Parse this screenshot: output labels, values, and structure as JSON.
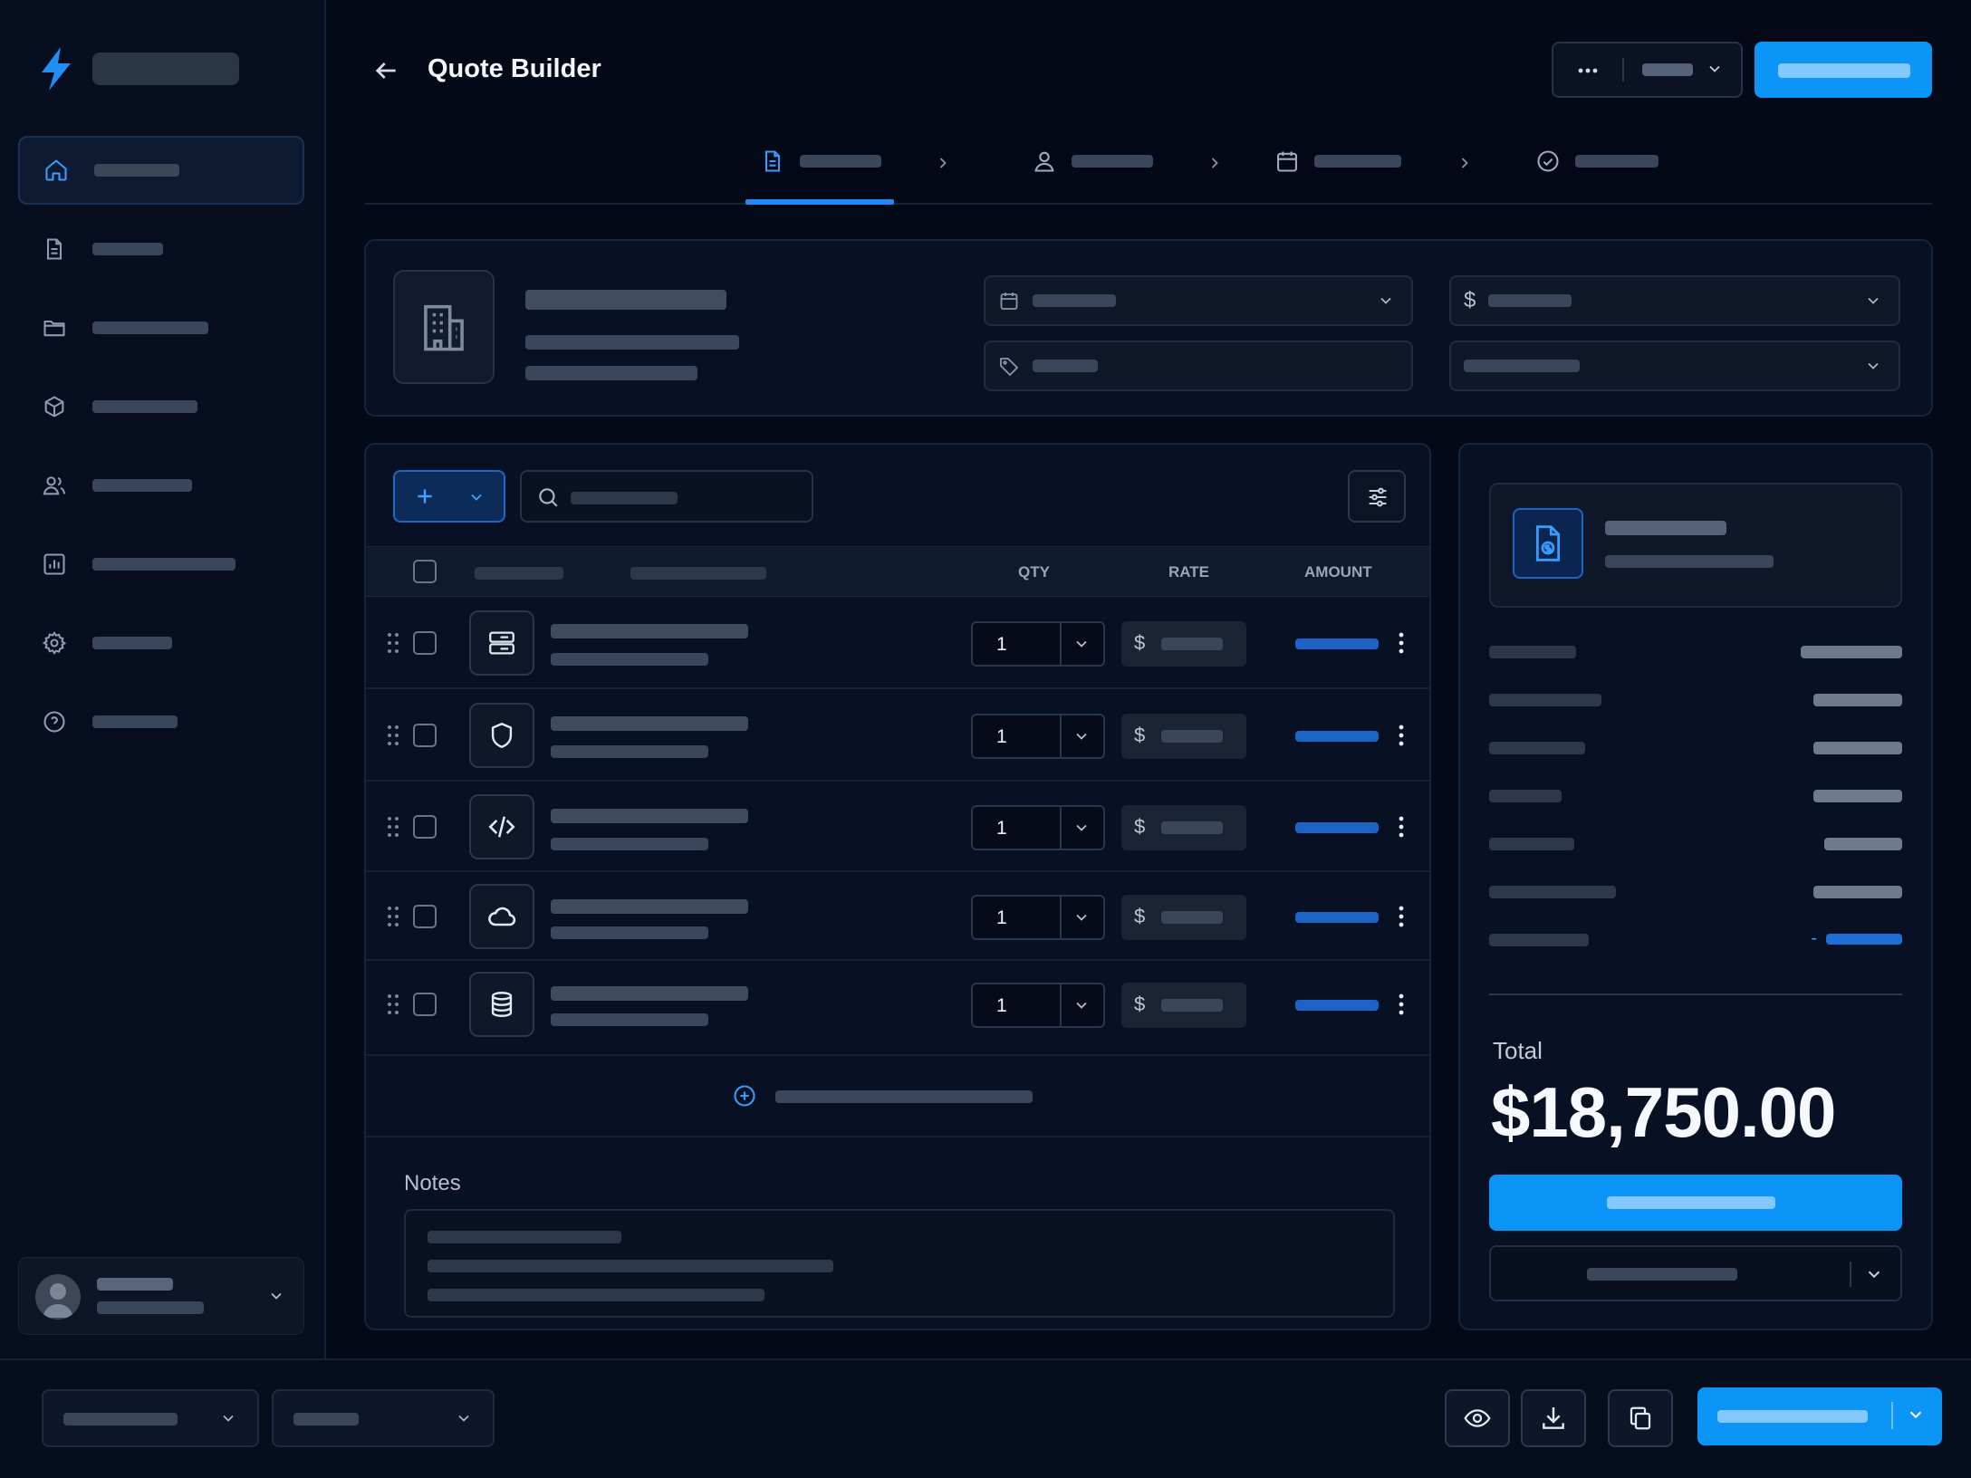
{
  "header": {
    "title": "Quote Builder"
  },
  "nav": {
    "items": [
      {
        "icon": "home-icon",
        "active": true
      },
      {
        "icon": "document-icon"
      },
      {
        "icon": "folder-icon"
      },
      {
        "icon": "box-icon"
      },
      {
        "icon": "users-icon"
      },
      {
        "icon": "chart-icon"
      },
      {
        "icon": "gear-icon"
      },
      {
        "icon": "help-icon"
      }
    ]
  },
  "steps": [
    {
      "icon": "file-icon",
      "active": true
    },
    {
      "icon": "user-icon"
    },
    {
      "icon": "calendar-icon"
    },
    {
      "icon": "check-circle-icon"
    }
  ],
  "details": {
    "currency_symbol": "$"
  },
  "table": {
    "columns": {
      "qty": "QTY",
      "rate": "RATE",
      "amount": "AMOUNT"
    },
    "rows": [
      {
        "icon": "server-icon",
        "qty": "1",
        "currency": "$"
      },
      {
        "icon": "shield-icon",
        "qty": "1",
        "currency": "$"
      },
      {
        "icon": "code-icon",
        "qty": "1",
        "currency": "$"
      },
      {
        "icon": "cloud-icon",
        "qty": "1",
        "currency": "$"
      },
      {
        "icon": "database-icon",
        "qty": "1",
        "currency": "$"
      }
    ]
  },
  "notes": {
    "label": "Notes"
  },
  "summary": {
    "discount_sign": "-",
    "total_label": "Total",
    "total_value": "$18,750.00"
  },
  "colors": {
    "accent": "#0b95f6",
    "accent_text": "#3a9bff",
    "background": "#030916"
  }
}
